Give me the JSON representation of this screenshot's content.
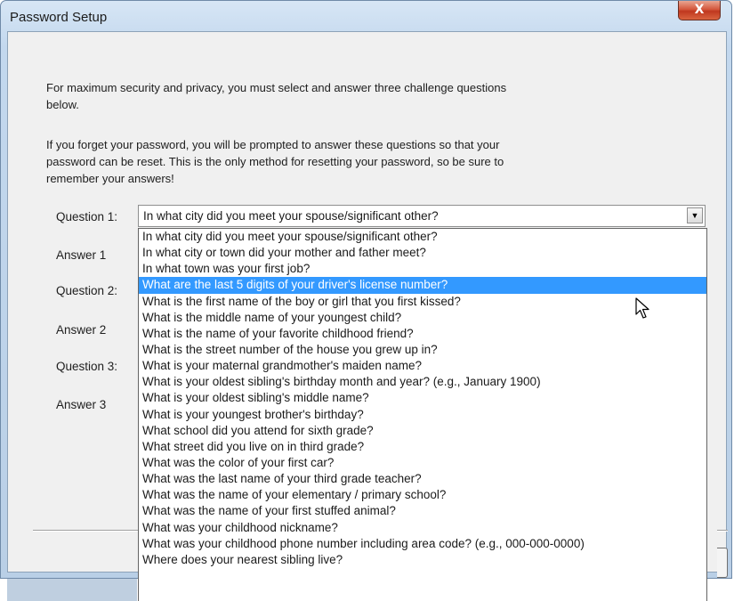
{
  "window": {
    "title": "Password Setup",
    "close_label": "X"
  },
  "intro": {
    "paragraph1": "For maximum security and privacy, you must select and answer three challenge questions below.",
    "paragraph2": "If you forget your password, you will be prompted to answer these questions so that your password can be reset. This is the only method for resetting your password, so be sure to remember your answers!"
  },
  "form": {
    "question1_label": "Question 1:",
    "answer1_label": "Answer 1",
    "question2_label": "Question 2:",
    "answer2_label": "Answer 2",
    "question3_label": "Question 3:",
    "answer3_label": "Answer 3",
    "question1_value": "In what city did you meet your spouse/significant other?"
  },
  "dropdown": {
    "selected_index": 3,
    "options": [
      "In what city did you meet your spouse/significant other?",
      "In what city or town did your mother and father meet?",
      "In what town was your first job?",
      "What are the last 5 digits of your driver's license number?",
      "What is the first name of the boy or girl that you first kissed?",
      "What is the middle name of your youngest child?",
      "What is the name of your favorite childhood friend?",
      "What is the street number of the house you grew up in?",
      "What is your maternal grandmother's maiden name?",
      "What is your oldest sibling's birthday month and year? (e.g., January 1900)",
      "What is your oldest sibling's middle name?",
      "What is your youngest brother's birthday?",
      "What school did you attend for sixth grade?",
      "What street did you live on in third grade?",
      "What was the color of your first car?",
      "What was the last name of your third grade teacher?",
      "What was the name of your elementary / primary school?",
      "What was the name of your first stuffed animal?",
      "What was your childhood nickname?",
      "What was your childhood phone number including area code? (e.g., 000-000-0000)",
      "Where does your nearest sibling live?"
    ]
  },
  "icons": {
    "close": "close-icon",
    "dropdown_arrow": "chevron-down-icon",
    "cursor": "mouse-pointer-icon"
  },
  "colors": {
    "selection": "#3399ff",
    "close_button": "#c9452a"
  }
}
